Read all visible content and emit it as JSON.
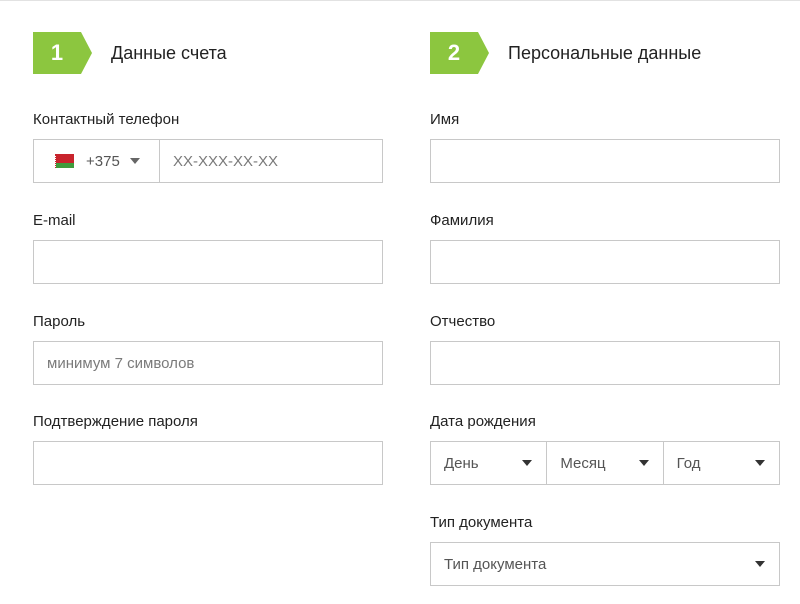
{
  "steps": [
    {
      "number": "1",
      "title": "Данные счета"
    },
    {
      "number": "2",
      "title": "Персональные данные"
    }
  ],
  "colors": {
    "accent_green": "#8cc63f"
  },
  "account": {
    "phone": {
      "label": "Контактный телефон",
      "country_code": "+375",
      "flag": "belarus-flag",
      "placeholder": "XX-XXX-XX-XX"
    },
    "email": {
      "label": "E-mail",
      "placeholder": ""
    },
    "password": {
      "label": "Пароль",
      "placeholder": "минимум 7 символов"
    },
    "password_confirm": {
      "label": "Подтверждение пароля",
      "placeholder": ""
    }
  },
  "personal": {
    "first_name": {
      "label": "Имя",
      "placeholder": ""
    },
    "last_name": {
      "label": "Фамилия",
      "placeholder": ""
    },
    "middle_name": {
      "label": "Отчество",
      "placeholder": ""
    },
    "birth_date": {
      "label": "Дата рождения",
      "day": "День",
      "month": "Месяц",
      "year": "Год"
    },
    "document_type": {
      "label": "Тип документа",
      "selected": "Тип документа"
    }
  }
}
